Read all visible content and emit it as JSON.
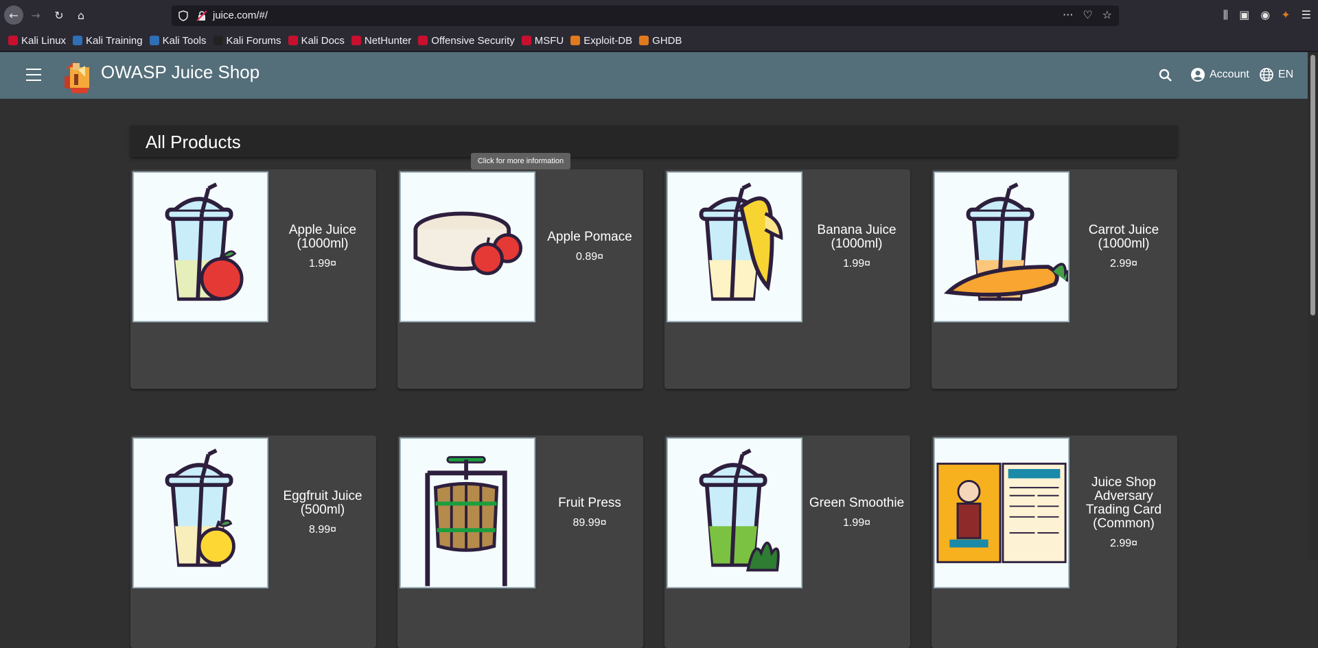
{
  "browser": {
    "url": "juice.com/#/",
    "bookmarks": [
      {
        "label": "Kali Linux",
        "color": "#c8102e"
      },
      {
        "label": "Kali Training",
        "color": "#2f6fb5"
      },
      {
        "label": "Kali Tools",
        "color": "#2f6fb5"
      },
      {
        "label": "Kali Forums",
        "color": "#222222"
      },
      {
        "label": "Kali Docs",
        "color": "#c8102e"
      },
      {
        "label": "NetHunter",
        "color": "#c8102e"
      },
      {
        "label": "Offensive Security",
        "color": "#c8102e"
      },
      {
        "label": "MSFU",
        "color": "#c8102e"
      },
      {
        "label": "Exploit-DB",
        "color": "#e07a1f"
      },
      {
        "label": "GHDB",
        "color": "#e07a1f"
      }
    ]
  },
  "app": {
    "title": "OWASP Juice Shop",
    "account_label": "Account",
    "language_label": "EN",
    "toolbar_color": "#546e7a"
  },
  "main": {
    "heading": "All Products",
    "tooltip": "Click for more information",
    "products": [
      {
        "name": "Apple Juice (1000ml)",
        "price": "1.99¤",
        "image": "apple-juice"
      },
      {
        "name": "Apple Pomace",
        "price": "0.89¤",
        "image": "apple-pomace"
      },
      {
        "name": "Banana Juice (1000ml)",
        "price": "1.99¤",
        "image": "banana-juice"
      },
      {
        "name": "Carrot Juice (1000ml)",
        "price": "2.99¤",
        "image": "carrot-juice"
      },
      {
        "name": "Eggfruit Juice (500ml)",
        "price": "8.99¤",
        "image": "eggfruit-juice"
      },
      {
        "name": "Fruit Press",
        "price": "89.99¤",
        "image": "fruit-press"
      },
      {
        "name": "Green Smoothie",
        "price": "1.99¤",
        "image": "green-smoothie"
      },
      {
        "name": "Juice Shop Adversary Trading Card (Common)",
        "price": "2.99¤",
        "image": "trading-card"
      }
    ]
  }
}
